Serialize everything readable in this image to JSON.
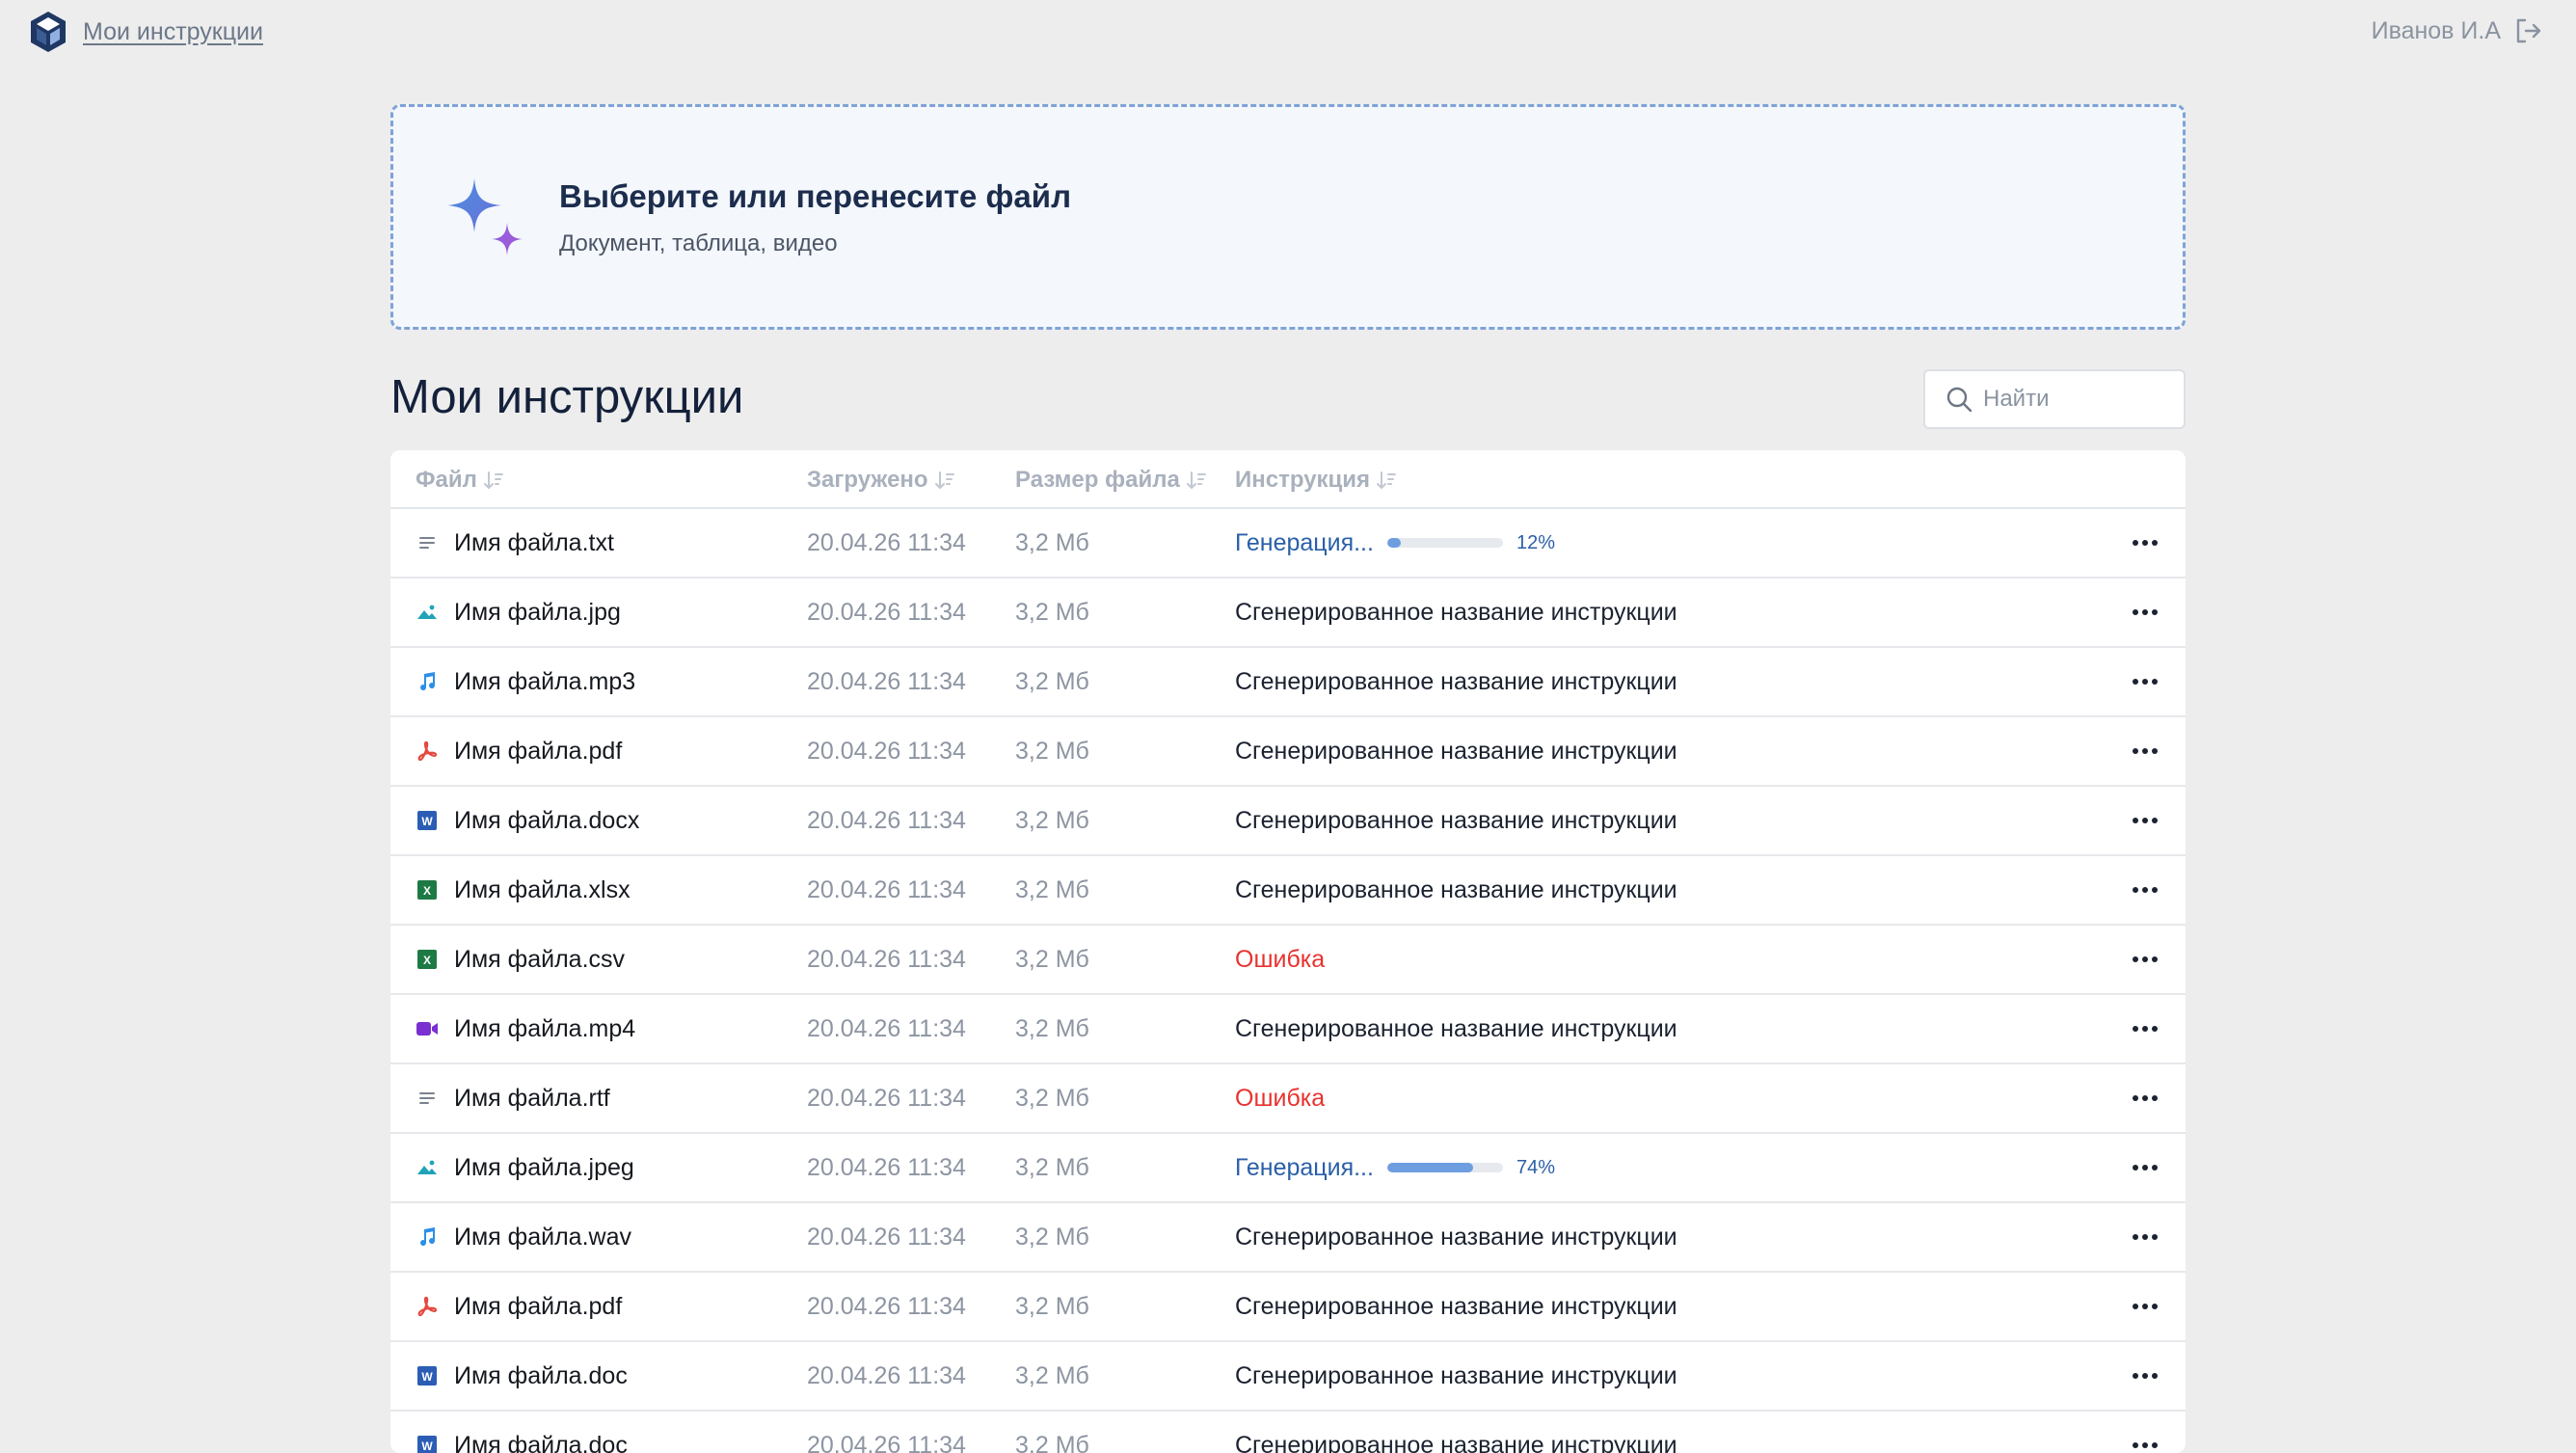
{
  "app": {
    "title": "Мои инструкции",
    "user_name": "Иванов И.А"
  },
  "upload": {
    "title": "Выберите или перенесите файл",
    "subtitle": "Документ, таблица, видео"
  },
  "section": {
    "title": "Мои инструкции"
  },
  "search": {
    "placeholder": "Найти"
  },
  "table": {
    "columns": [
      "Файл",
      "Загружено",
      "Размер файла",
      "Инструкция"
    ],
    "rows": [
      {
        "file": "Имя файла.txt",
        "type": "text",
        "date": "20.04.26 11:34",
        "size": "3,2 Мб",
        "status": "generating",
        "instruction": "Генерация...",
        "progress": 12,
        "progress_label": "12%"
      },
      {
        "file": "Имя файла.jpg",
        "type": "image",
        "date": "20.04.26 11:34",
        "size": "3,2 Мб",
        "status": "done",
        "instruction": "Сгенерированное название инструкции"
      },
      {
        "file": "Имя файла.mp3",
        "type": "audio",
        "date": "20.04.26 11:34",
        "size": "3,2 Мб",
        "status": "done",
        "instruction": "Сгенерированное название инструкции"
      },
      {
        "file": "Имя файла.pdf",
        "type": "pdf",
        "date": "20.04.26 11:34",
        "size": "3,2 Мб",
        "status": "done",
        "instruction": "Сгенерированное название инструкции"
      },
      {
        "file": "Имя файла.docx",
        "type": "word",
        "date": "20.04.26 11:34",
        "size": "3,2 Мб",
        "status": "done",
        "instruction": "Сгенерированное название инструкции"
      },
      {
        "file": "Имя файла.xlsx",
        "type": "excel",
        "date": "20.04.26 11:34",
        "size": "3,2 Мб",
        "status": "done",
        "instruction": "Сгенерированное название инструкции"
      },
      {
        "file": "Имя файла.csv",
        "type": "excel",
        "date": "20.04.26 11:34",
        "size": "3,2 Мб",
        "status": "error",
        "instruction": "Ошибка"
      },
      {
        "file": "Имя файла.mp4",
        "type": "video",
        "date": "20.04.26 11:34",
        "size": "3,2 Мб",
        "status": "done",
        "instruction": "Сгенерированное название инструкции"
      },
      {
        "file": "Имя файла.rtf",
        "type": "text",
        "date": "20.04.26 11:34",
        "size": "3,2 Мб",
        "status": "error",
        "instruction": "Ошибка"
      },
      {
        "file": "Имя файла.jpeg",
        "type": "image",
        "date": "20.04.26 11:34",
        "size": "3,2 Мб",
        "status": "generating",
        "instruction": "Генерация...",
        "progress": 74,
        "progress_label": "74%"
      },
      {
        "file": "Имя файла.wav",
        "type": "audio",
        "date": "20.04.26 11:34",
        "size": "3,2 Мб",
        "status": "done",
        "instruction": "Сгенерированное название инструкции"
      },
      {
        "file": "Имя файла.pdf",
        "type": "pdf",
        "date": "20.04.26 11:34",
        "size": "3,2 Мб",
        "status": "done",
        "instruction": "Сгенерированное название инструкции"
      },
      {
        "file": "Имя файла.doc",
        "type": "word",
        "date": "20.04.26 11:34",
        "size": "3,2 Мб",
        "status": "done",
        "instruction": "Сгенерированное название инструкции"
      },
      {
        "file": "Имя файла.doc",
        "type": "word",
        "date": "20.04.26 11:34",
        "size": "3,2 Мб",
        "status": "done",
        "instruction": "Сгенерированное название инструкции"
      }
    ]
  },
  "colors": {
    "background": "#ededed",
    "accent": "#2a5fa8",
    "error": "#e8322f",
    "progress_fill": "#6e9ee0"
  }
}
